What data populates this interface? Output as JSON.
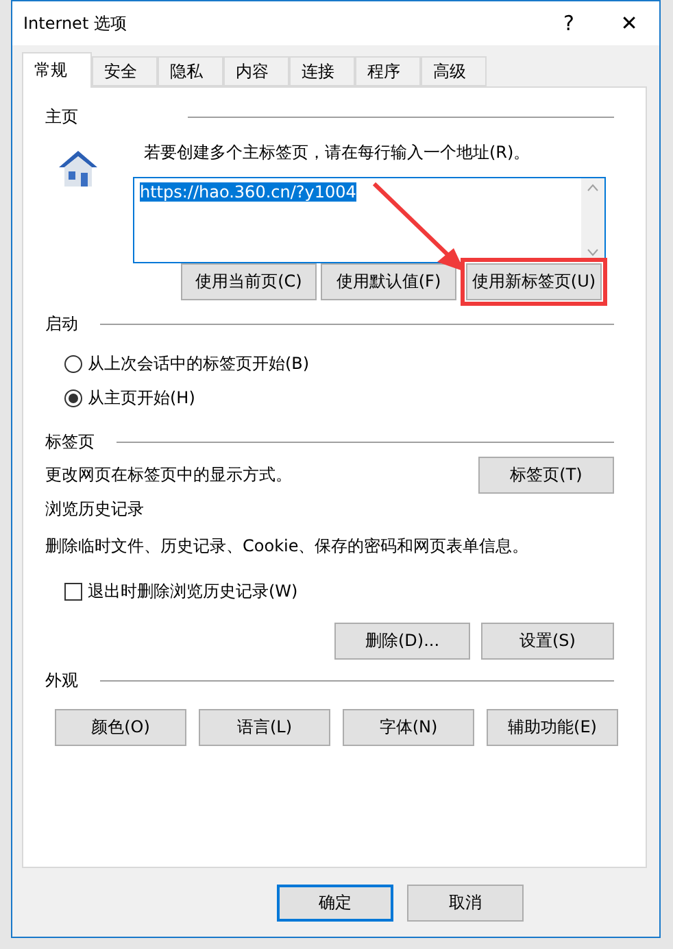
{
  "window": {
    "title": "Internet 选项",
    "help_glyph": "?",
    "close_glyph": "✕"
  },
  "tabs": [
    {
      "label": "常规",
      "selected": true
    },
    {
      "label": "安全",
      "selected": false
    },
    {
      "label": "隐私",
      "selected": false
    },
    {
      "label": "内容",
      "selected": false
    },
    {
      "label": "连接",
      "selected": false
    },
    {
      "label": "程序",
      "selected": false
    },
    {
      "label": "高级",
      "selected": false
    }
  ],
  "home": {
    "heading": "主页",
    "instruction": "若要创建多个主标签页，请在每行输入一个地址(R)。",
    "value": "https://hao.360.cn/?y1004",
    "value_selected": true,
    "buttons": [
      {
        "label": "使用当前页(C)",
        "highlighted": false
      },
      {
        "label": "使用默认值(F)",
        "highlighted": false
      },
      {
        "label": "使用新标签页(U)",
        "highlighted": true
      }
    ]
  },
  "startup": {
    "heading": "启动",
    "options": [
      {
        "label": "从上次会话中的标签页开始(B)",
        "selected": false
      },
      {
        "label": "从主页开始(H)",
        "selected": true
      }
    ]
  },
  "tabs_section": {
    "heading": "标签页",
    "text": "更改网页在标签页中的显示方式。",
    "button": "标签页(T)"
  },
  "history": {
    "heading": "浏览历史记录",
    "text": "删除临时文件、历史记录、Cookie、保存的密码和网页表单信息。",
    "checkbox": {
      "label": "退出时删除浏览历史记录(W)",
      "checked": false
    },
    "buttons": [
      "删除(D)...",
      "设置(S)"
    ]
  },
  "appearance": {
    "heading": "外观",
    "buttons": [
      "颜色(O)",
      "语言(L)",
      "字体(N)",
      "辅助功能(E)"
    ]
  },
  "footer": {
    "buttons": [
      {
        "label": "确定",
        "default": true
      },
      {
        "label": "取消",
        "default": false
      }
    ]
  }
}
